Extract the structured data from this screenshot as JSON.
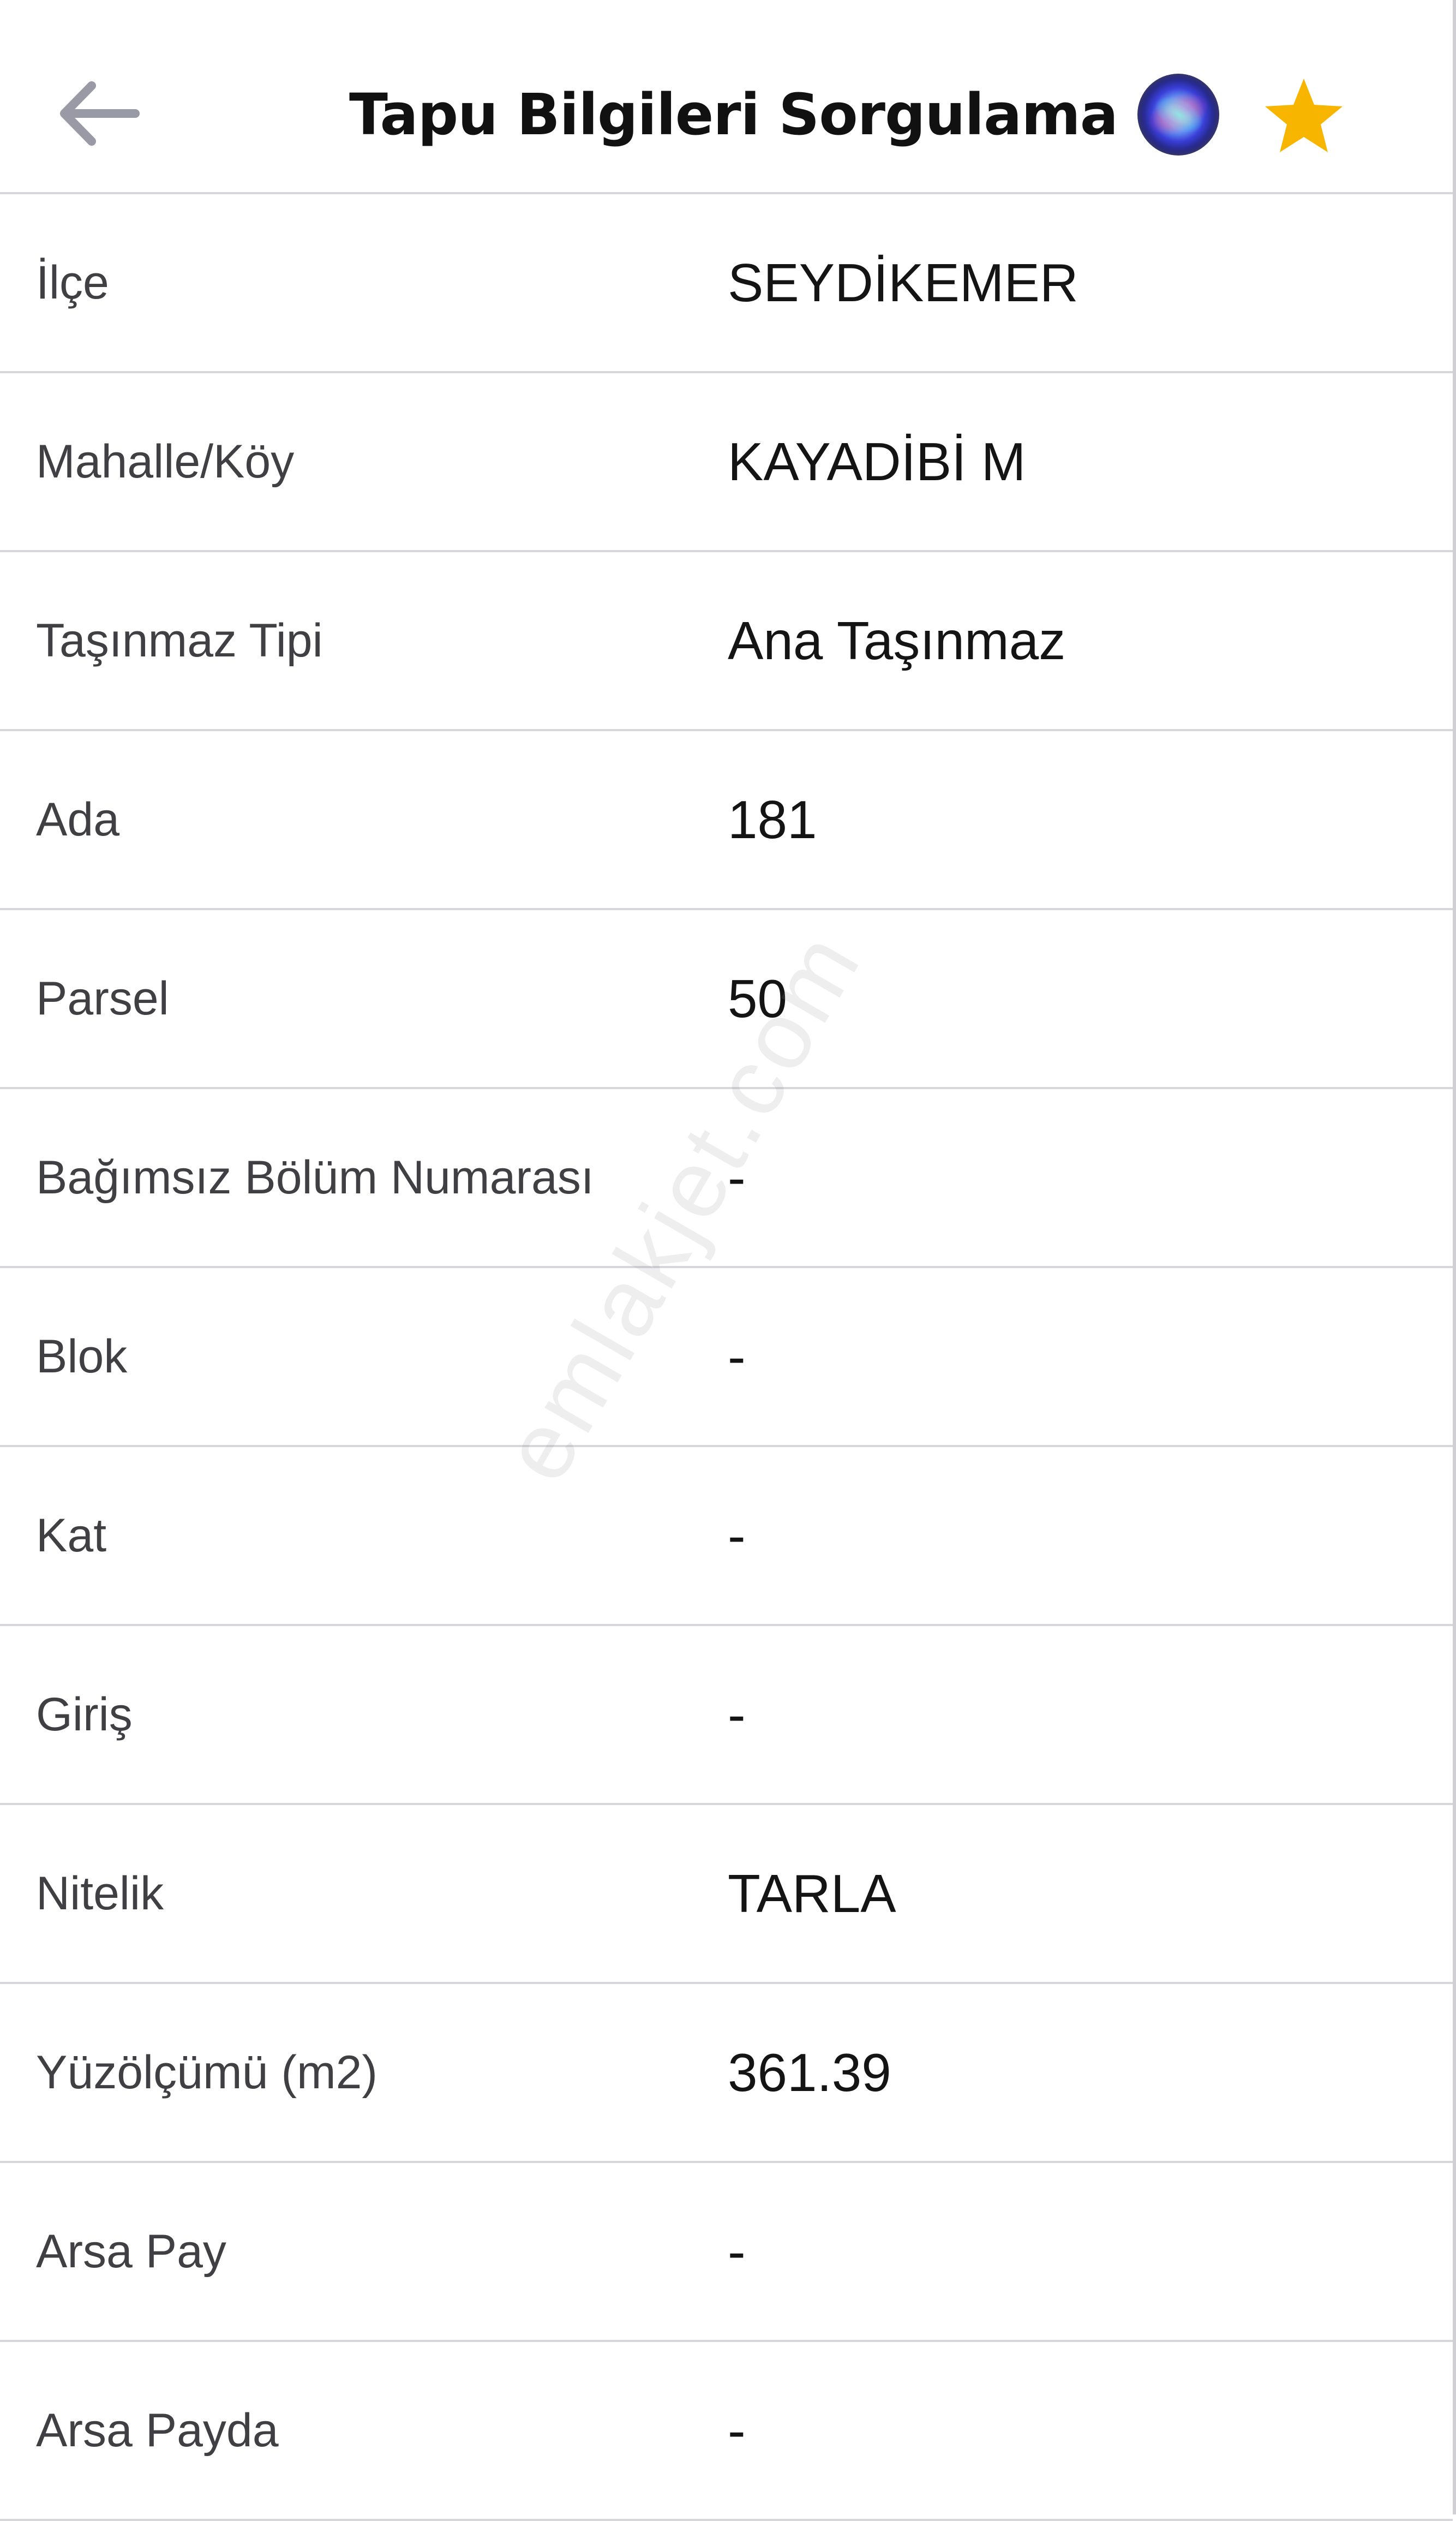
{
  "header": {
    "title": "Tapu Bilgileri Sorgulama",
    "back_icon": "arrow-left-icon",
    "assistant_icon": "siri-icon",
    "favorite_icon": "star-icon",
    "favorite_color": "#F7B500",
    "back_color": "#9A9AA6"
  },
  "rows": [
    {
      "label": "İlçe",
      "value": "SEYDİKEMER"
    },
    {
      "label": "Mahalle/Köy",
      "value": "KAYADİBİ M"
    },
    {
      "label": "Taşınmaz Tipi",
      "value": "Ana Taşınmaz"
    },
    {
      "label": "Ada",
      "value": "181"
    },
    {
      "label": "Parsel",
      "value": "50"
    },
    {
      "label": "Bağımsız Bölüm Numarası",
      "value": "-"
    },
    {
      "label": "Blok",
      "value": "-"
    },
    {
      "label": "Kat",
      "value": "-"
    },
    {
      "label": "Giriş",
      "value": "-"
    },
    {
      "label": "Nitelik",
      "value": "TARLA"
    },
    {
      "label": "Yüzölçümü (m2)",
      "value": "361.39"
    },
    {
      "label": "Arsa Pay",
      "value": "-"
    },
    {
      "label": "Arsa Payda",
      "value": "-"
    }
  ],
  "watermark": "emlakjet.com"
}
